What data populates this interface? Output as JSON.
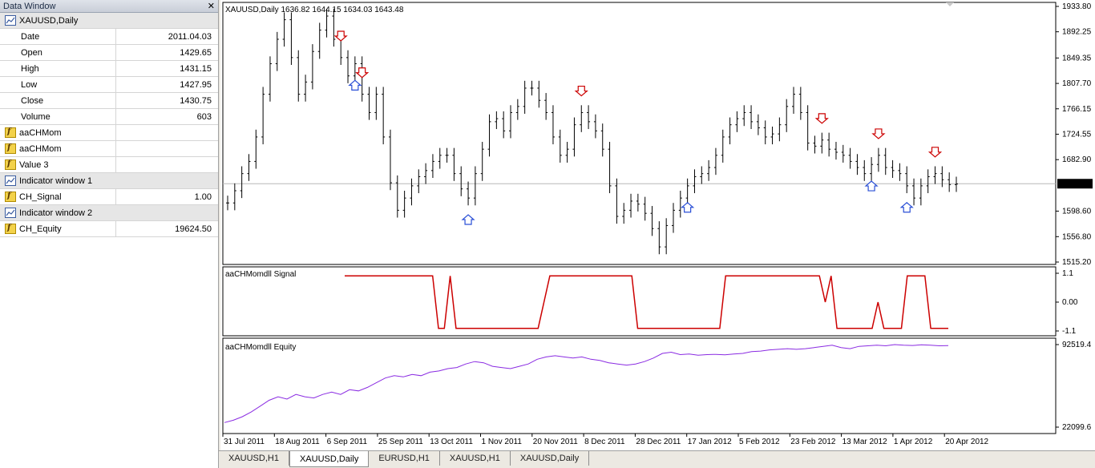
{
  "data_window": {
    "title": "Data Window",
    "rows": [
      {
        "type": "header",
        "icon": "chart-window-icon",
        "name": "XAUUSD,Daily",
        "value": ""
      },
      {
        "type": "field",
        "name": "Date",
        "value": "2011.04.03"
      },
      {
        "type": "field",
        "name": "Open",
        "value": "1429.65"
      },
      {
        "type": "field",
        "name": "High",
        "value": "1431.15"
      },
      {
        "type": "field",
        "name": "Low",
        "value": "1427.95"
      },
      {
        "type": "field",
        "name": "Close",
        "value": "1430.75"
      },
      {
        "type": "field",
        "name": "Volume",
        "value": "603"
      },
      {
        "type": "indicator",
        "icon": "indicator-icon",
        "name": "aaCHMom",
        "value": ""
      },
      {
        "type": "indicator",
        "icon": "indicator-icon",
        "name": "aaCHMom",
        "value": ""
      },
      {
        "type": "indicator",
        "icon": "indicator-icon",
        "name": "Value 3",
        "value": ""
      },
      {
        "type": "header",
        "icon": "chart-window-icon",
        "name": "Indicator window 1",
        "value": ""
      },
      {
        "type": "indicator",
        "icon": "indicator-icon",
        "name": "CH_Signal",
        "value": "1.00"
      },
      {
        "type": "header",
        "icon": "chart-window-icon",
        "name": "Indicator window 2",
        "value": ""
      },
      {
        "type": "indicator",
        "icon": "indicator-icon",
        "name": "CH_Equity",
        "value": "19624.50"
      }
    ]
  },
  "main_chart": {
    "header": "XAUUSD,Daily  1636.82 1644.15 1634.03 1643.48",
    "price_ticks": [
      "1933.80",
      "1892.25",
      "1849.35",
      "1807.70",
      "1766.15",
      "1724.55",
      "1682.90",
      "1598.60",
      "1556.80",
      "1515.20"
    ],
    "current_price": "1643.48",
    "ylim": [
      1515.2,
      1933.8
    ],
    "price_values": [
      1612,
      1632,
      1660,
      1680,
      1720,
      1790,
      1840,
      1880,
      1912,
      1850,
      1790,
      1810,
      1860,
      1895,
      1918,
      1880,
      1850,
      1820,
      1840,
      1790,
      1760,
      1790,
      1720,
      1645,
      1600,
      1620,
      1640,
      1655,
      1665,
      1680,
      1690,
      1690,
      1660,
      1635,
      1620,
      1660,
      1700,
      1745,
      1750,
      1730,
      1760,
      1770,
      1800,
      1800,
      1780,
      1760,
      1720,
      1690,
      1700,
      1740,
      1760,
      1745,
      1730,
      1700,
      1640,
      1590,
      1600,
      1615,
      1610,
      1595,
      1570,
      1540,
      1575,
      1600,
      1620,
      1640,
      1655,
      1660,
      1670,
      1690,
      1720,
      1740,
      1750,
      1760,
      1745,
      1735,
      1720,
      1725,
      1740,
      1770,
      1790,
      1760,
      1710,
      1705,
      1715,
      1700,
      1695,
      1690,
      1680,
      1670,
      1660,
      1675,
      1690,
      1670,
      1665,
      1660,
      1640,
      1620,
      1640,
      1655,
      1660,
      1650,
      1642,
      1643
    ]
  },
  "signal_chart": {
    "title": "aaCHMomdll Signal",
    "ticks": [
      "1.1",
      "0.00",
      "-1.1"
    ],
    "ylim": [
      -1.1,
      1.1
    ],
    "values": [
      1,
      1,
      1,
      1,
      1,
      1,
      1,
      1,
      1,
      1,
      1,
      1,
      1,
      1,
      1,
      1,
      -1,
      -1,
      1,
      -1,
      -1,
      -1,
      -1,
      -1,
      -1,
      -1,
      -1,
      -1,
      -1,
      -1,
      -1,
      -1,
      -1,
      -1,
      0,
      1,
      1,
      1,
      1,
      1,
      1,
      1,
      1,
      1,
      1,
      1,
      1,
      1,
      1,
      1,
      -1,
      -1,
      -1,
      -1,
      -1,
      -1,
      -1,
      -1,
      -1,
      -1,
      -1,
      -1,
      -1,
      -1,
      -1,
      1,
      1,
      1,
      1,
      1,
      1,
      1,
      1,
      1,
      1,
      1,
      1,
      1,
      1,
      1,
      1,
      1,
      0,
      1,
      -1,
      -1,
      -1,
      -1,
      -1,
      -1,
      -1,
      0,
      -1,
      -1,
      -1,
      -1,
      1,
      1,
      1,
      1,
      -1,
      -1,
      -1,
      -1
    ]
  },
  "equity_chart": {
    "title": "aaCHMomdll Equity",
    "ticks": [
      "92519.4",
      "22099.6"
    ],
    "ylim": [
      22099.6,
      92519.4
    ],
    "values": [
      26000,
      28000,
      31000,
      35000,
      40000,
      45000,
      48000,
      46000,
      50000,
      48000,
      47000,
      50000,
      52000,
      50000,
      54000,
      53000,
      56000,
      60000,
      64000,
      66000,
      65000,
      67000,
      66000,
      69000,
      70000,
      72000,
      73000,
      76000,
      78000,
      77000,
      74000,
      73000,
      72000,
      74000,
      76000,
      80000,
      82000,
      83000,
      82000,
      81000,
      82000,
      80000,
      79000,
      77000,
      76000,
      75000,
      76000,
      78000,
      81000,
      85000,
      86000,
      84000,
      84500,
      83500,
      84000,
      84200,
      83800,
      84500,
      85000,
      86500,
      87000,
      88000,
      88500,
      89000,
      88500,
      89000,
      90000,
      91000,
      92000,
      90000,
      89000,
      91000,
      91500,
      92000,
      91500,
      92500,
      92000,
      91800,
      92300,
      92000,
      91500,
      91600
    ]
  },
  "x_ticks": [
    "31 Jul 2011",
    "18 Aug 2011",
    "6 Sep 2011",
    "25 Sep 2011",
    "13 Oct 2011",
    "1 Nov 2011",
    "20 Nov 2011",
    "8 Dec 2011",
    "28 Dec 2011",
    "17 Jan 2012",
    "5 Feb 2012",
    "23 Feb 2012",
    "13 Mar 2012",
    "1 Apr 2012",
    "20 Apr 2012"
  ],
  "tabs": [
    {
      "label": "XAUUSD,H1",
      "active": false
    },
    {
      "label": "XAUUSD,Daily",
      "active": true
    },
    {
      "label": "EURUSD,H1",
      "active": false
    },
    {
      "label": "XAUUSD,H1",
      "active": false
    },
    {
      "label": "XAUUSD,Daily",
      "active": false
    }
  ],
  "colors": {
    "signal_line": "#cc0000",
    "equity_line": "#8a2be2",
    "sell_arrow": "#cc0000",
    "buy_arrow": "#2a4fd6"
  }
}
